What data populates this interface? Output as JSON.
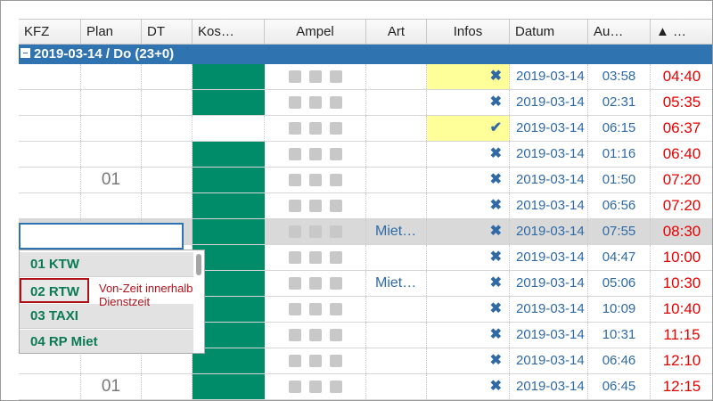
{
  "columns": [
    "KFZ",
    "Plan",
    "DT",
    "Kos…",
    "Ampel",
    "Art",
    "Infos",
    "Datum",
    "Au…",
    "▲ …"
  ],
  "group": {
    "label": "2019-03-14 / Do (23+0)"
  },
  "rows": [
    {
      "plan": "",
      "art": "",
      "infos": "cross",
      "infos_yellow": true,
      "kos_green": true,
      "datum": "2019-03-14",
      "au": "03:58",
      "last": "04:40",
      "selected": false
    },
    {
      "plan": "",
      "art": "",
      "infos": "cross",
      "infos_yellow": false,
      "kos_green": true,
      "datum": "2019-03-14",
      "au": "02:31",
      "last": "05:35",
      "selected": false
    },
    {
      "plan": "",
      "art": "",
      "infos": "check",
      "infos_yellow": true,
      "kos_green": false,
      "datum": "2019-03-14",
      "au": "06:15",
      "last": "06:37",
      "selected": false
    },
    {
      "plan": "",
      "art": "",
      "infos": "cross",
      "infos_yellow": false,
      "kos_green": true,
      "datum": "2019-03-14",
      "au": "01:16",
      "last": "06:40",
      "selected": false
    },
    {
      "plan": "01",
      "art": "",
      "infos": "cross",
      "infos_yellow": false,
      "kos_green": true,
      "datum": "2019-03-14",
      "au": "01:50",
      "last": "07:20",
      "selected": false
    },
    {
      "plan": "",
      "art": "",
      "infos": "cross",
      "infos_yellow": false,
      "kos_green": true,
      "datum": "2019-03-14",
      "au": "06:56",
      "last": "07:20",
      "selected": false
    },
    {
      "plan": "",
      "art": "Miet…",
      "infos": "cross",
      "infos_yellow": false,
      "kos_green": true,
      "datum": "2019-03-14",
      "au": "07:55",
      "last": "08:30",
      "selected": true
    },
    {
      "plan": "",
      "art": "",
      "infos": "cross",
      "infos_yellow": false,
      "kos_green": true,
      "datum": "2019-03-14",
      "au": "04:47",
      "last": "10:00",
      "selected": false
    },
    {
      "plan": "",
      "art": "Miet…",
      "infos": "cross",
      "infos_yellow": false,
      "kos_green": true,
      "datum": "2019-03-14",
      "au": "05:06",
      "last": "10:30",
      "selected": false
    },
    {
      "plan": "",
      "art": "",
      "infos": "cross",
      "infos_yellow": false,
      "kos_green": true,
      "datum": "2019-03-14",
      "au": "10:09",
      "last": "10:40",
      "selected": false
    },
    {
      "plan": "",
      "art": "",
      "infos": "cross",
      "infos_yellow": false,
      "kos_green": true,
      "datum": "2019-03-14",
      "au": "10:31",
      "last": "11:15",
      "selected": false
    },
    {
      "plan": "",
      "art": "",
      "infos": "cross",
      "infos_yellow": false,
      "kos_green": true,
      "datum": "2019-03-14",
      "au": "06:46",
      "last": "12:10",
      "selected": false
    },
    {
      "plan": "01",
      "art": "",
      "infos": "cross",
      "infos_yellow": false,
      "kos_green": true,
      "datum": "2019-03-14",
      "au": "06:45",
      "last": "12:15",
      "selected": false
    }
  ],
  "dropdown": {
    "items": [
      "01 KTW",
      "02 RTW",
      "03 TAXI",
      "04 RP Miet"
    ],
    "highlighted_index": 1,
    "tooltip_line1": "Von-Zeit innerhalb",
    "tooltip_line2": "Dienstzeit"
  },
  "editor": {
    "value": ""
  },
  "colors": {
    "header_group": "#2f73b0",
    "kos_green": "#008c69",
    "infos_yellow": "#ffff99",
    "time_red": "#e60000",
    "link_blue": "#2f6aa6"
  }
}
